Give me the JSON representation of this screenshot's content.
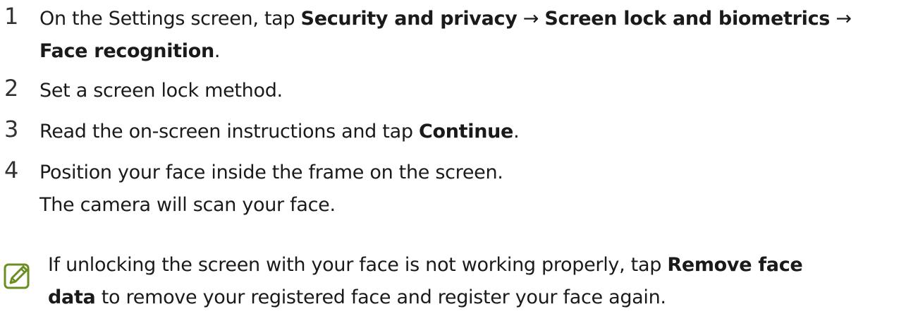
{
  "steps": [
    {
      "number": "1",
      "lines": [
        [
          {
            "t": "On the Settings screen, tap ",
            "b": false
          },
          {
            "t": "Security and privacy",
            "b": true
          },
          {
            "t": " → ",
            "b": false
          },
          {
            "t": "Screen lock and biometrics",
            "b": true
          },
          {
            "t": " →",
            "b": false
          }
        ],
        [
          {
            "t": "Face recognition",
            "b": true
          },
          {
            "t": ".",
            "b": false
          }
        ]
      ]
    },
    {
      "number": "2",
      "lines": [
        [
          {
            "t": "Set a screen lock method.",
            "b": false
          }
        ]
      ]
    },
    {
      "number": "3",
      "lines": [
        [
          {
            "t": "Read the on-screen instructions and tap ",
            "b": false
          },
          {
            "t": "Continue",
            "b": true
          },
          {
            "t": ".",
            "b": false
          }
        ]
      ]
    },
    {
      "number": "4",
      "lines": [
        [
          {
            "t": "Position your face inside the frame on the screen.",
            "b": false
          }
        ],
        [
          {
            "t": "The camera will scan your face.",
            "b": false
          }
        ]
      ]
    }
  ],
  "note": {
    "icon": "note-pencil-icon",
    "lines": [
      [
        {
          "t": "If unlocking the screen with your face is not working properly, tap ",
          "b": false
        },
        {
          "t": "Remove face",
          "b": true
        }
      ],
      [
        {
          "t": "data",
          "b": true
        },
        {
          "t": " to remove your registered face and register your face again.",
          "b": false
        }
      ]
    ]
  },
  "colors": {
    "text": "#1a1a1a",
    "number": "#333333",
    "note_icon": "#6b8e23"
  }
}
